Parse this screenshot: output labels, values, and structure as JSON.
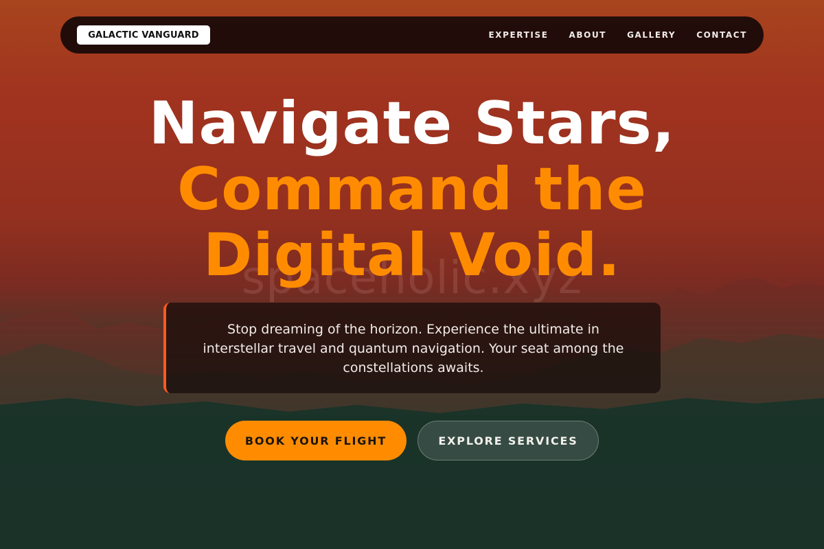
{
  "brand": {
    "logo_text": "GALACTIC VANGUARD"
  },
  "nav": {
    "items": [
      {
        "label": "EXPERTISE"
      },
      {
        "label": "ABOUT"
      },
      {
        "label": "GALLERY"
      },
      {
        "label": "CONTACT"
      }
    ]
  },
  "hero": {
    "headline_line1": "Navigate Stars,",
    "headline_line2": "Command the",
    "headline_line3": "Digital Void.",
    "watermark": "spaceholic.xyz",
    "tagline": "Stop dreaming of the horizon. Experience the ultimate in interstellar travel and quantum navigation. Your seat among the constellations awaits."
  },
  "cta": {
    "primary_label": "BOOK YOUR FLIGHT",
    "secondary_label": "EXPLORE SERVICES"
  },
  "colors": {
    "accent": "#ff8c00",
    "accent_border": "#ff5a1f",
    "nav_background": "#180a08",
    "sky_top": "#a8441e",
    "ground": "#0b2a24"
  }
}
